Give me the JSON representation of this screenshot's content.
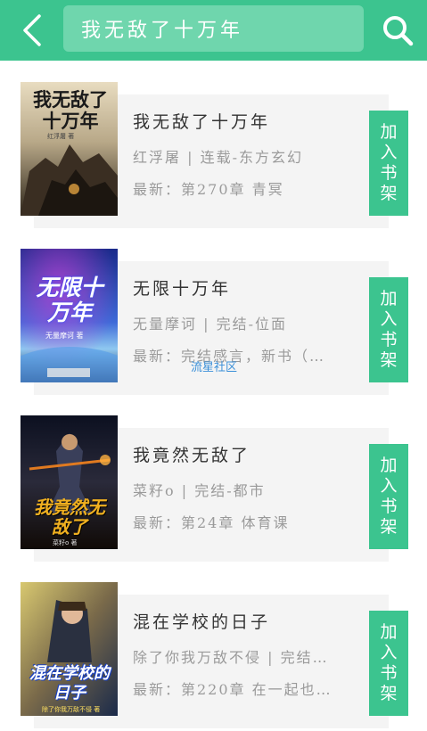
{
  "search": {
    "query": "我无敌了十万年"
  },
  "colors": {
    "accent": "#3cc48f",
    "card": "#f4f4f4",
    "muted": "#9a9a9a"
  },
  "books": [
    {
      "title": "我无敌了十万年",
      "meta": "红浮屠 | 连载-东方玄幻",
      "latest": "最新：第270章 青冥",
      "add_label": [
        "加",
        "入",
        "书",
        "架"
      ],
      "cover": {
        "title_art": "我无敌了十万年",
        "author_art": "红浮屠 著"
      }
    },
    {
      "title": "无限十万年",
      "meta": "无量摩诃 | 完结-位面",
      "latest": "最新：完结感言，新书（…",
      "add_label": [
        "加",
        "入",
        "书",
        "架"
      ],
      "cover": {
        "title_art": "无限十万年",
        "author_art": "无量摩诃 著"
      }
    },
    {
      "title": "我竟然无敌了",
      "meta": "菜籽o | 完结-都市",
      "latest": "最新：第24章 体育课",
      "add_label": [
        "加",
        "入",
        "书",
        "架"
      ],
      "cover": {
        "title_art": "我竟然无敌了",
        "author_art": "菜籽o 著"
      }
    },
    {
      "title": "混在学校的日子",
      "meta": "除了你我万敌不侵 | 完结…",
      "latest": "最新：第220章 在一起也…",
      "add_label": [
        "加",
        "入",
        "书",
        "架"
      ],
      "cover": {
        "title_art": "混在学校的日子",
        "author_art": "除了你我万敌不侵 著"
      }
    }
  ],
  "watermark": "流星社区",
  "icons": {
    "back": "chevron-left-icon",
    "search": "search-icon"
  }
}
